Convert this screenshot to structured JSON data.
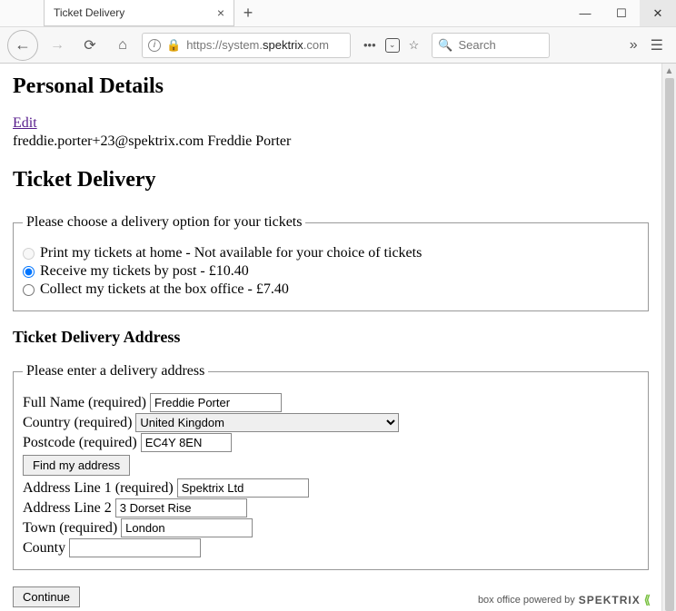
{
  "browser": {
    "tab_title": "Ticket Delivery",
    "url_host": "https://system.",
    "url_domain": "spektrix",
    "url_rest": ".com",
    "search_placeholder": "Search"
  },
  "page": {
    "personal_details_heading": "Personal Details",
    "edit_link": "Edit",
    "user_line": "freddie.porter+23@spektrix.com Freddie Porter",
    "ticket_delivery_heading": "Ticket Delivery",
    "delivery_legend": "Please choose a delivery option for your tickets",
    "radios": {
      "print": "Print my tickets at home - Not available for your choice of tickets",
      "post": "Receive my tickets by post - £10.40",
      "collect": "Collect my tickets at the box office - £7.40"
    },
    "address_heading": "Ticket Delivery Address",
    "address_legend": "Please enter a delivery address",
    "labels": {
      "fullname": "Full Name (required)",
      "country": "Country (required)",
      "postcode": "Postcode (required)",
      "find": "Find my address",
      "addr1": "Address Line 1 (required)",
      "addr2": "Address Line 2",
      "town": "Town (required)",
      "county": "County"
    },
    "values": {
      "fullname": "Freddie Porter",
      "country": "United Kingdom",
      "postcode": "EC4Y 8EN",
      "addr1": "Spektrix Ltd",
      "addr2": "3 Dorset Rise",
      "town": "London",
      "county": ""
    },
    "continue_label": "Continue",
    "footer_prefix": "box office powered by",
    "footer_brand": "SPEKTRIX"
  }
}
